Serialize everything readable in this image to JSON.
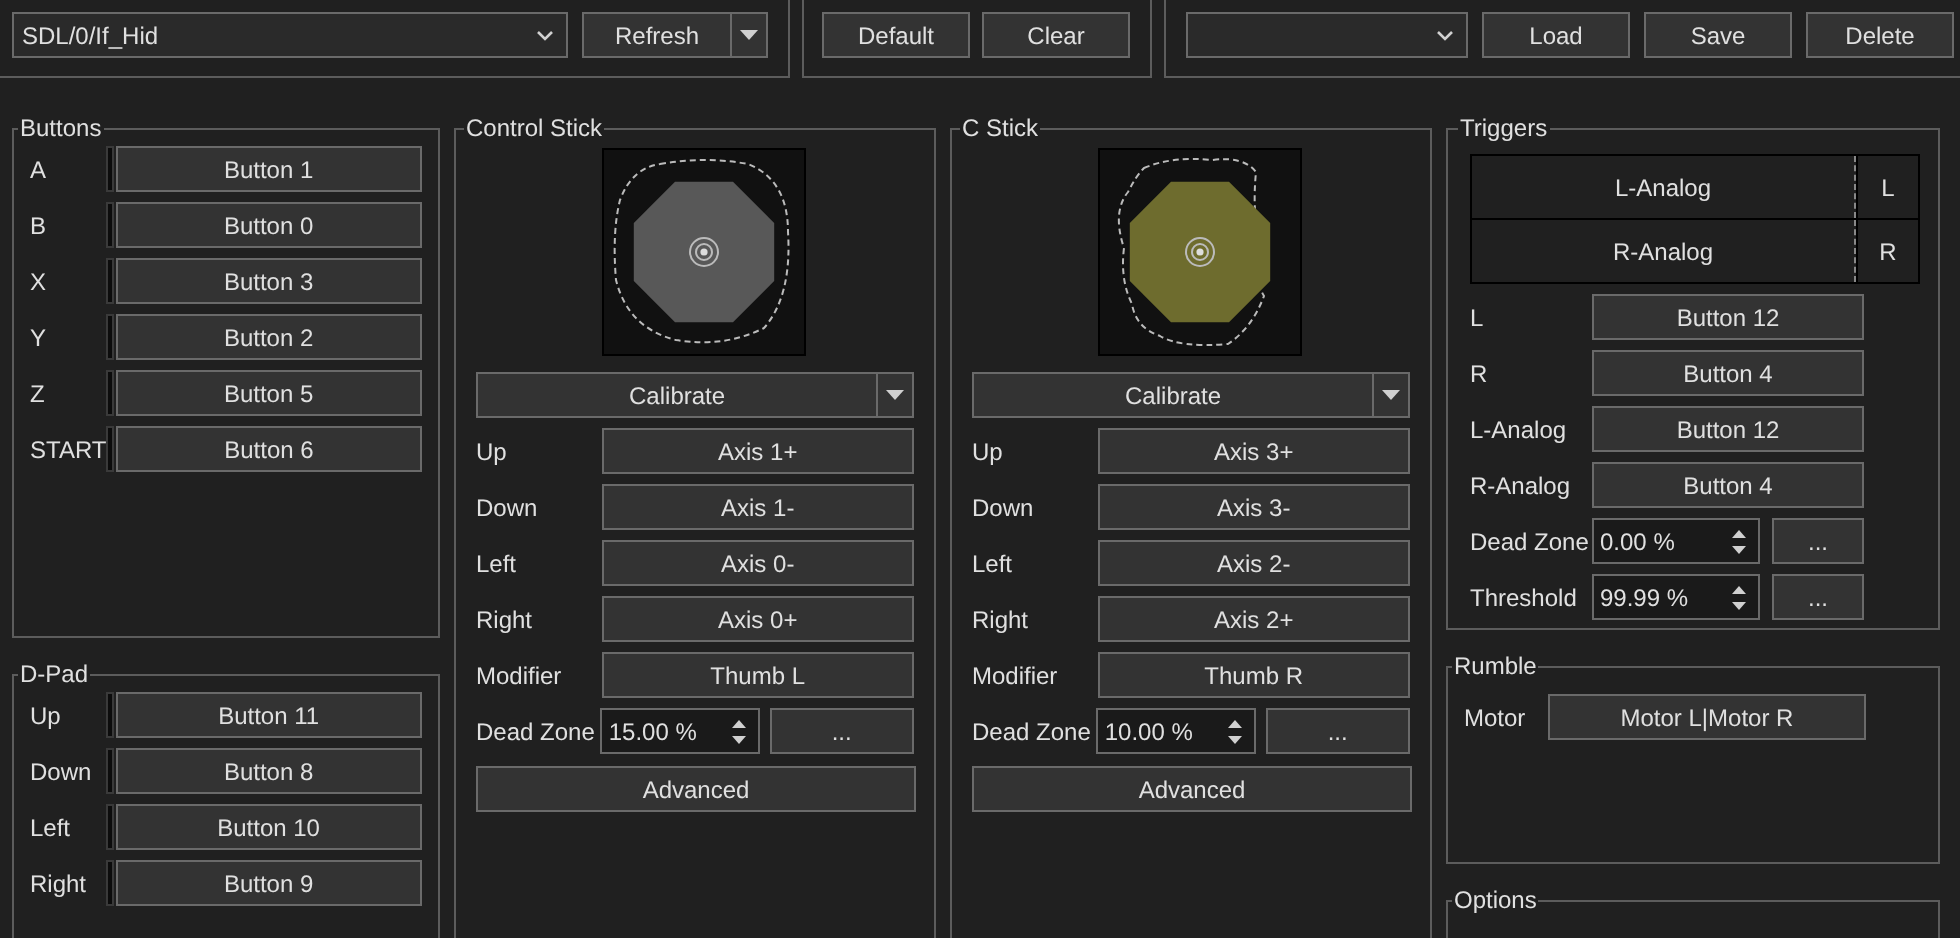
{
  "device": {
    "value": "SDL/0/If_Hid",
    "refresh": "Refresh"
  },
  "mapping_buttons": [
    "Default",
    "Clear"
  ],
  "profile": {
    "buttons": [
      "Load",
      "Save",
      "Delete"
    ]
  },
  "buttons": {
    "title": "Buttons",
    "rows": [
      {
        "label": "A",
        "binding": "Button 1"
      },
      {
        "label": "B",
        "binding": "Button 0"
      },
      {
        "label": "X",
        "binding": "Button 3"
      },
      {
        "label": "Y",
        "binding": "Button 2"
      },
      {
        "label": "Z",
        "binding": "Button 5"
      },
      {
        "label": "START",
        "binding": "Button 6"
      }
    ]
  },
  "dpad": {
    "title": "D-Pad",
    "rows": [
      {
        "label": "Up",
        "binding": "Button 11"
      },
      {
        "label": "Down",
        "binding": "Button 8"
      },
      {
        "label": "Left",
        "binding": "Button 10"
      },
      {
        "label": "Right",
        "binding": "Button 9"
      }
    ]
  },
  "sticks": [
    {
      "title": "Control Stick",
      "color": "#585858",
      "calibrate": "Calibrate",
      "advanced": "Advanced",
      "rows": [
        {
          "kind": "binding",
          "label": "Up",
          "binding": "Axis 1+"
        },
        {
          "kind": "binding",
          "label": "Down",
          "binding": "Axis 1-"
        },
        {
          "kind": "binding",
          "label": "Left",
          "binding": "Axis 0-"
        },
        {
          "kind": "binding",
          "label": "Right",
          "binding": "Axis 0+"
        },
        {
          "kind": "binding",
          "label": "Modifier",
          "binding": "Thumb L"
        },
        {
          "kind": "spin",
          "label": "Dead Zone",
          "value": "15.00 %",
          "more": "..."
        }
      ]
    },
    {
      "title": "C Stick",
      "color": "#6e6c2e",
      "calibrate": "Calibrate",
      "advanced": "Advanced",
      "rows": [
        {
          "kind": "binding",
          "label": "Up",
          "binding": "Axis 3+"
        },
        {
          "kind": "binding",
          "label": "Down",
          "binding": "Axis 3-"
        },
        {
          "kind": "binding",
          "label": "Left",
          "binding": "Axis 2-"
        },
        {
          "kind": "binding",
          "label": "Right",
          "binding": "Axis 2+"
        },
        {
          "kind": "binding",
          "label": "Modifier",
          "binding": "Thumb R"
        },
        {
          "kind": "spin",
          "label": "Dead Zone",
          "value": "10.00 %",
          "more": "..."
        }
      ]
    }
  ],
  "triggers": {
    "title": "Triggers",
    "meters": [
      {
        "label": "L-Analog",
        "key": "L",
        "level": 0
      },
      {
        "label": "R-Analog",
        "key": "R",
        "level": 0
      }
    ],
    "rows": [
      {
        "kind": "binding",
        "label": "L",
        "binding": "Button 12"
      },
      {
        "kind": "binding",
        "label": "R",
        "binding": "Button 4"
      },
      {
        "kind": "binding",
        "label": "L-Analog",
        "binding": "Button 12"
      },
      {
        "kind": "binding",
        "label": "R-Analog",
        "binding": "Button 4"
      },
      {
        "kind": "spin",
        "label": "Dead Zone",
        "value": "0.00 %",
        "more": "..."
      },
      {
        "kind": "spin",
        "label": "Threshold",
        "value": "99.99 %",
        "more": "..."
      }
    ]
  },
  "rumble": {
    "title": "Rumble",
    "rows": [
      {
        "label": "Motor",
        "binding": "Motor L|Motor R"
      }
    ]
  },
  "options": {
    "title": "Options"
  }
}
